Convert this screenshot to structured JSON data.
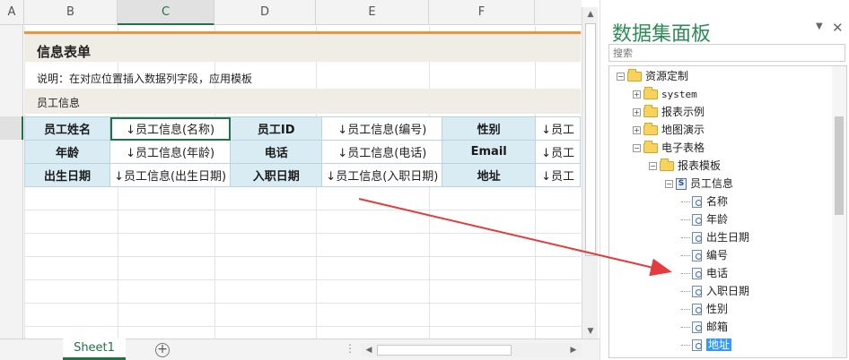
{
  "sheet": {
    "columns": [
      "A",
      "B",
      "C",
      "D",
      "E",
      "F"
    ],
    "form_title": "信息表单",
    "description": "说明：在对应位置插入数据列字段，应用模板",
    "section_label": "员工信息",
    "rows": [
      [
        {
          "text": "员工姓名",
          "type": "label"
        },
        {
          "text": "↓员工信息(名称)",
          "type": "value"
        },
        {
          "text": "员工ID",
          "type": "label"
        },
        {
          "text": "↓员工信息(编号)",
          "type": "value"
        },
        {
          "text": "性别",
          "type": "label"
        },
        {
          "text": "↓员工",
          "type": "value"
        }
      ],
      [
        {
          "text": "年龄",
          "type": "label"
        },
        {
          "text": "↓员工信息(年龄)",
          "type": "value"
        },
        {
          "text": "电话",
          "type": "label"
        },
        {
          "text": "↓员工信息(电话)",
          "type": "value"
        },
        {
          "text": "Email",
          "type": "label"
        },
        {
          "text": "↓员工",
          "type": "value"
        }
      ],
      [
        {
          "text": "出生日期",
          "type": "label"
        },
        {
          "text": "↓员工信息(出生日期)",
          "type": "value"
        },
        {
          "text": "入职日期",
          "type": "label"
        },
        {
          "text": "↓员工信息(入职日期)",
          "type": "value"
        },
        {
          "text": "地址",
          "type": "label"
        },
        {
          "text": "↓员工",
          "type": "value"
        }
      ]
    ],
    "tab": "Sheet1",
    "add_tab": "+",
    "tab_dots": "⋮"
  },
  "panel": {
    "title": "数据集面板",
    "close": "✕",
    "pin": "▼",
    "search_placeholder": "搜索",
    "tree": [
      {
        "label": "资源定制",
        "kind": "folder",
        "expander": "-"
      },
      {
        "label": "system",
        "kind": "folder",
        "expander": "+"
      },
      {
        "label": "报表示例",
        "kind": "folder",
        "expander": "+"
      },
      {
        "label": "地图演示",
        "kind": "folder",
        "expander": "+"
      },
      {
        "label": "电子表格",
        "kind": "folder",
        "expander": "-"
      },
      {
        "label": "报表模板",
        "kind": "folder",
        "expander": "-"
      },
      {
        "label": "员工信息",
        "kind": "dataset",
        "expander": "-",
        "icon_text": "S"
      },
      {
        "label": "名称",
        "kind": "field"
      },
      {
        "label": "年龄",
        "kind": "field"
      },
      {
        "label": "出生日期",
        "kind": "field"
      },
      {
        "label": "编号",
        "kind": "field"
      },
      {
        "label": "电话",
        "kind": "field"
      },
      {
        "label": "入职日期",
        "kind": "field"
      },
      {
        "label": "性别",
        "kind": "field"
      },
      {
        "label": "邮箱",
        "kind": "field"
      },
      {
        "label": "地址",
        "kind": "field",
        "selected": true
      }
    ]
  },
  "colors": {
    "accent_green": "#217346",
    "title_bar_orange": "#f0913c",
    "label_cell_blue": "#d9ecf4",
    "panel_title_green": "#2e8b57",
    "drag_arrow_red": "#e23c3c",
    "tree_selection": "#3399ff"
  }
}
